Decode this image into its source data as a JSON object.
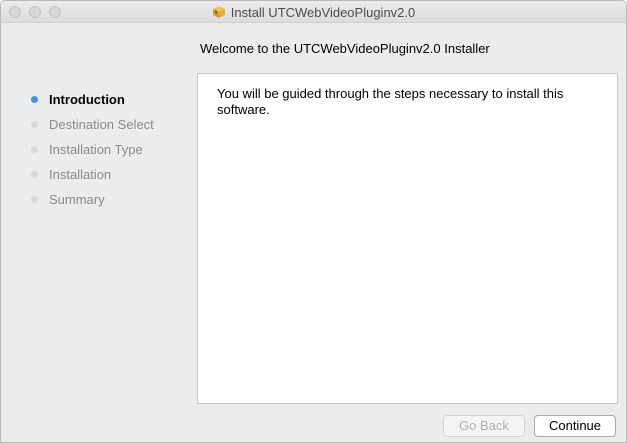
{
  "window": {
    "title": "Install UTCWebVideoPluginv2.0",
    "title_icon": "package-icon"
  },
  "header": {
    "welcome": "Welcome to the UTCWebVideoPluginv2.0 Installer"
  },
  "sidebar": {
    "items": [
      {
        "label": "Introduction",
        "active": true
      },
      {
        "label": "Destination Select",
        "active": false
      },
      {
        "label": "Installation Type",
        "active": false
      },
      {
        "label": "Installation",
        "active": false
      },
      {
        "label": "Summary",
        "active": false
      }
    ]
  },
  "main": {
    "body_text": "You will be guided through the steps necessary to install this software."
  },
  "buttons": {
    "back_label": "Go Back",
    "continue_label": "Continue"
  },
  "colors": {
    "active_step": "#4a90e2",
    "inactive_step": "#d8d8d8"
  }
}
